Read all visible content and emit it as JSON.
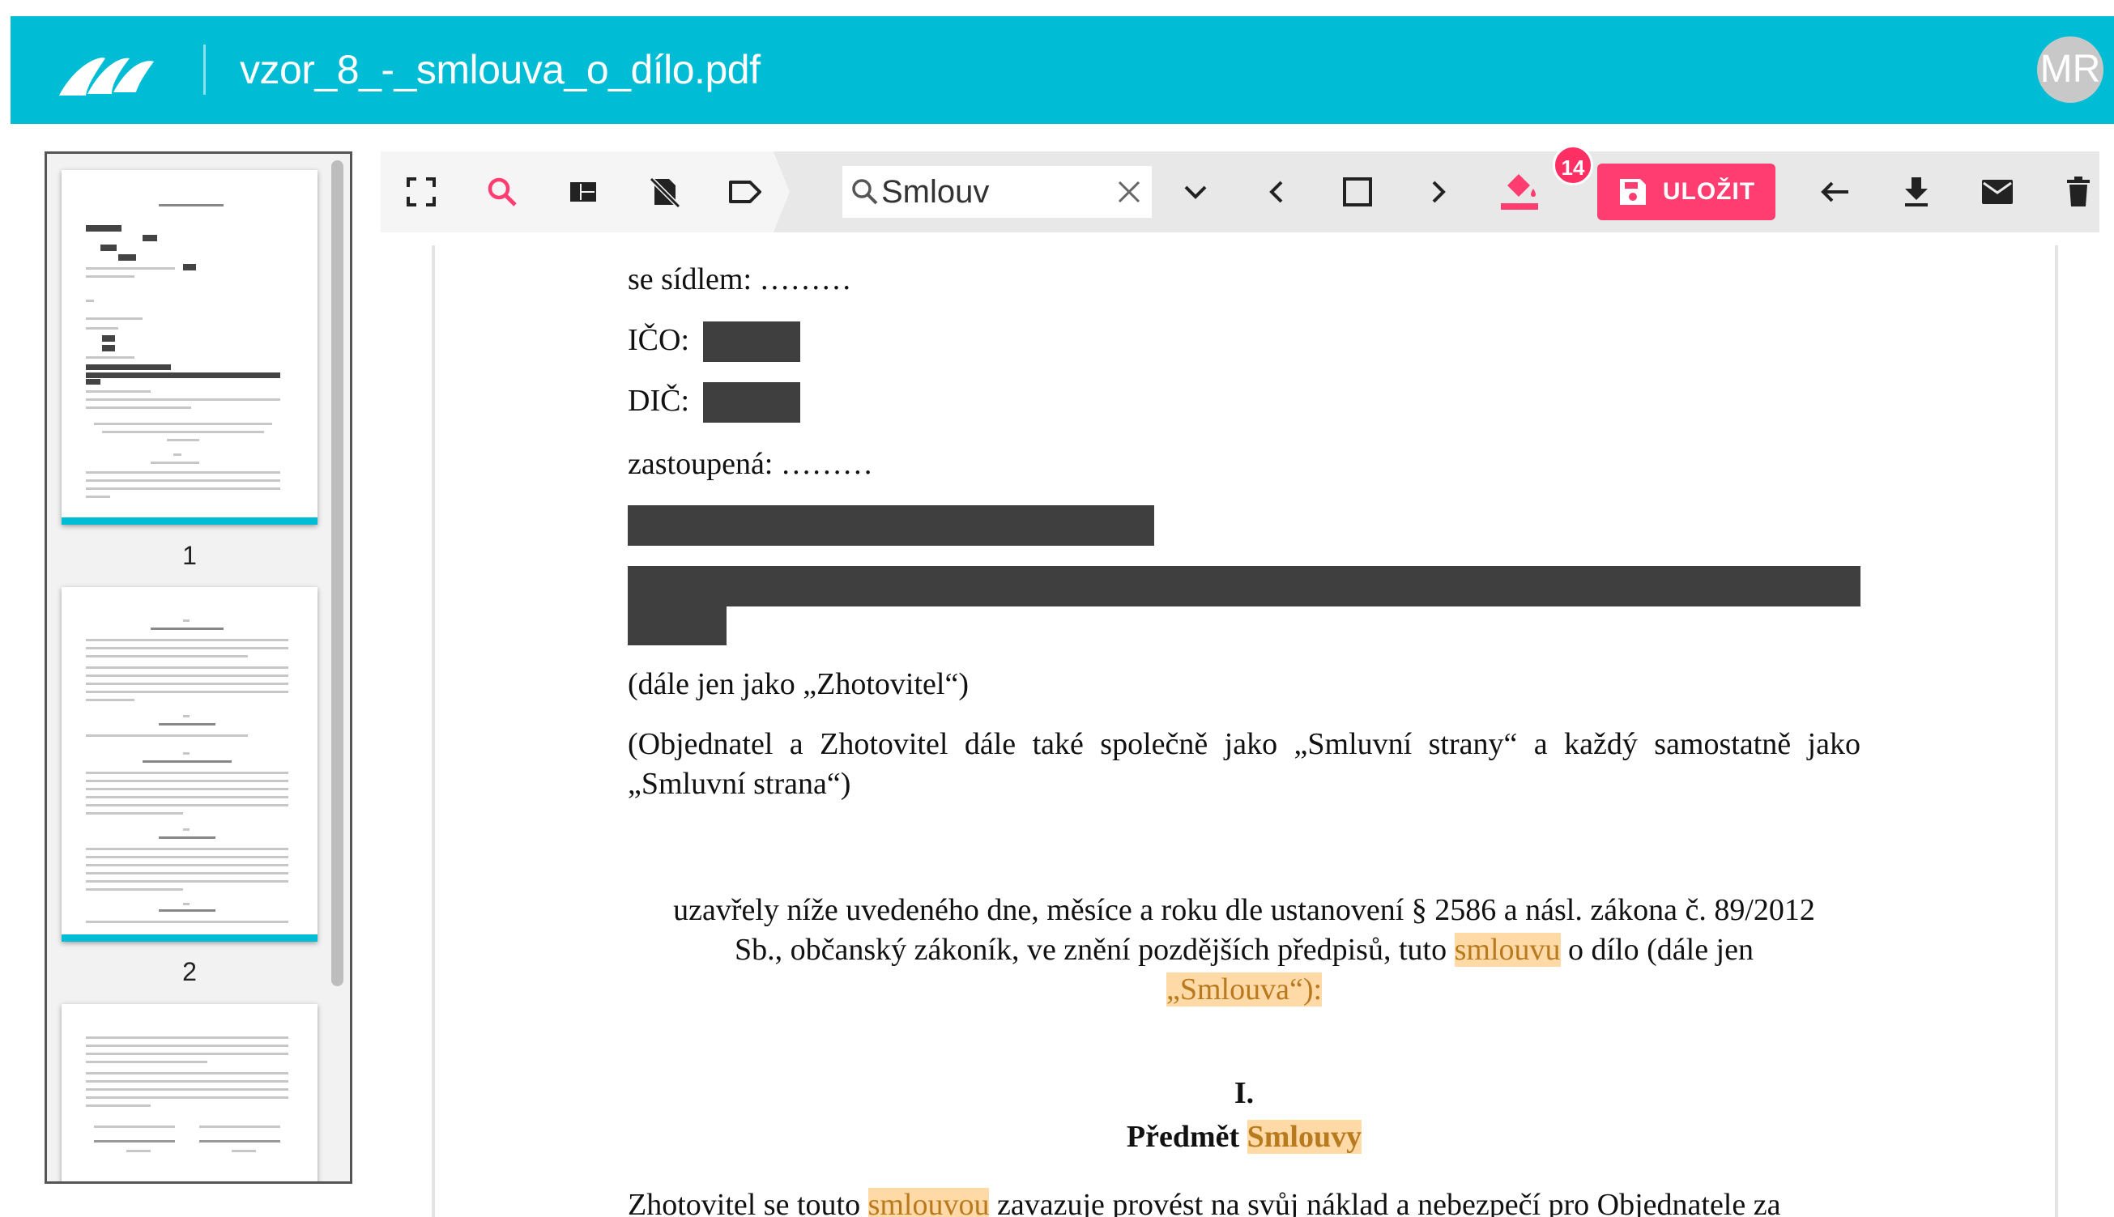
{
  "header": {
    "file_name": "vzor_8_-_smlouva_o_dílo.pdf",
    "avatar_initials": "MR",
    "brand_color": "#00bcd4"
  },
  "sidebar": {
    "pages": [
      "1",
      "2"
    ]
  },
  "toolbar": {
    "icons": [
      "fullscreen-icon",
      "search-icon",
      "layout-icon",
      "redact-page-icon",
      "label-icon"
    ],
    "search_value": "Smlouv",
    "badge_count": "14",
    "save_label": "ULOŽIT",
    "accent_color": "#ff3d71"
  },
  "document": {
    "line1": "se sídlem: ………",
    "ico_label": "IČO:",
    "dic_label": "DIČ:",
    "represented": "zastoupená: ………",
    "contractor_note": "(dále jen jako „Zhotovitel“)",
    "parties_note_1": "(Objednatel a Zhotovitel dále také společně jako „Smluvní strany“ a každý samostatně jako",
    "parties_note_2": "„Smluvní strana“)",
    "intro_1": "uzavřely níže uvedeného dne, měsíce a roku dle ustanovení § 2586 a násl. zákona č. 89/2012",
    "intro_2_pre": "Sb., občanský zákoník, ve znění pozdějších předpisů, tuto ",
    "intro_2_hl": "smlouvu",
    "intro_2_post": " o dílo (dále jen",
    "intro_3_hl": "„Smlouva“):",
    "section_number": "I.",
    "section_title_pre": "Předmět ",
    "section_title_hl": "Smlouvy",
    "cut_line_pre": "Zhotovitel se touto ",
    "cut_line_hl": "smlouvou",
    "cut_line_post": " zavazuje provést na svůj náklad a nebezpečí pro Objednatele za"
  }
}
